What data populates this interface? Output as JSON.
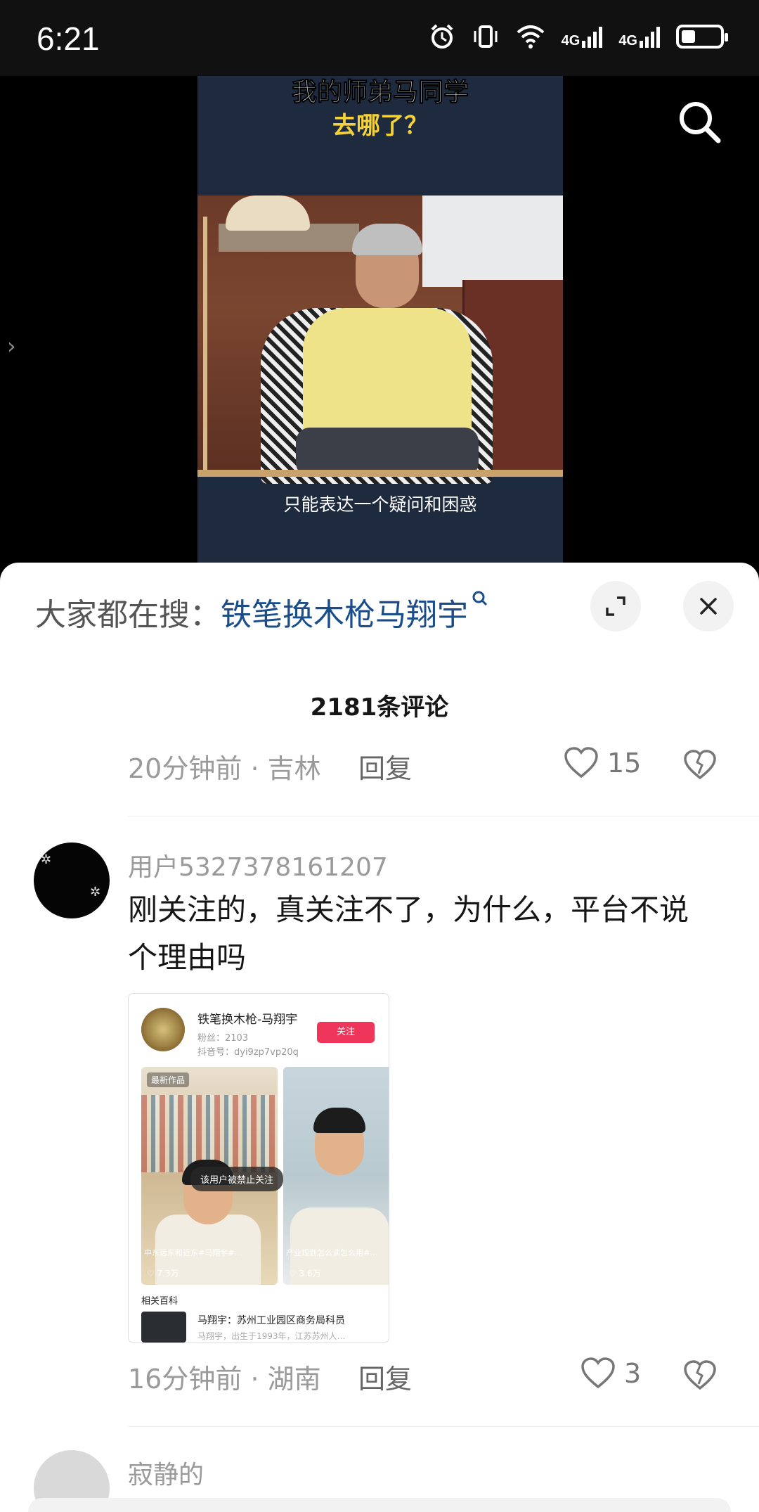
{
  "status_bar": {
    "time": "6:21",
    "network_1": "4G",
    "network_2": "4G",
    "battery_level": 0.38
  },
  "video": {
    "caption_top_line1": "我的师弟马同学",
    "caption_top_line2": "去哪了？",
    "subtitle": "只能表达一个疑问和困惑"
  },
  "search_bar": {
    "prefix": "大家都在搜：",
    "term": "铁笔换木枪马翔宇"
  },
  "comments_header": {
    "count_label": "2181条评论"
  },
  "comments": [
    {
      "time": "20分钟前",
      "location": "吉林",
      "reply_label": "回复",
      "likes": "15"
    },
    {
      "username": "用户5327378161207",
      "text": "刚关注的，真关注不了，为什么，平台不说个理由吗",
      "time": "16分钟前",
      "location": "湖南",
      "reply_label": "回复",
      "likes": "3",
      "embedded_image": {
        "account_name": "铁笔换木枪-马翔宇",
        "fans": "粉丝：2103",
        "douyin_id": "抖音号：dyi9zp7vp20q",
        "follow_label": "关注",
        "latest_label": "最新作品",
        "toast": "该用户被禁止关注",
        "video1_caption": "中东远东和近东#马翔宇#…",
        "video1_likes": "♡ 7.3万",
        "video2_caption": "产业规划怎么读怎么用#…",
        "video2_likes": "♡ 3.6万",
        "related_label": "相关百科",
        "related_title": "马翔宇：苏州工业园区商务局科员",
        "related_sub": "马翔宇，出生于1993年，江苏苏州人…"
      }
    },
    {
      "username": "寂静的"
    }
  ]
}
